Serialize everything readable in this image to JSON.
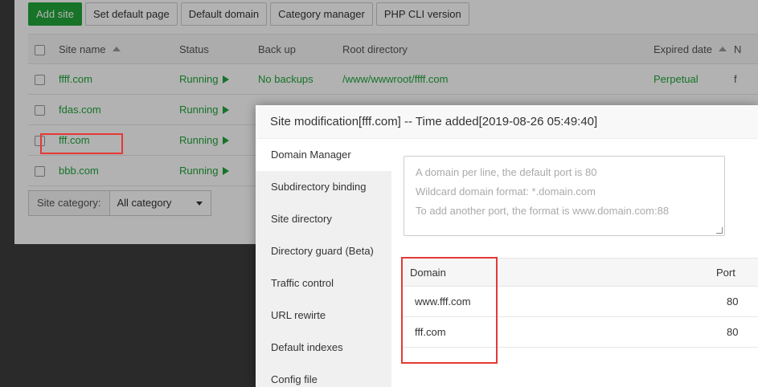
{
  "toolbar": {
    "add_site": "Add site",
    "set_default_page": "Set default page",
    "default_domain": "Default domain",
    "category_manager": "Category manager",
    "php_cli_version": "PHP CLI version"
  },
  "table": {
    "headers": {
      "site_name": "Site name",
      "status": "Status",
      "back_up": "Back up",
      "root_directory": "Root directory",
      "expired_date": "Expired date",
      "more": "N"
    },
    "rows": [
      {
        "name": "ffff.com",
        "status": "Running",
        "backup": "No backups",
        "root": "/www/wwwroot/ffff.com",
        "expired": "Perpetual",
        "more": "f"
      },
      {
        "name": "fdas.com",
        "status": "Running",
        "backup": "",
        "root": "",
        "expired": "",
        "more": ""
      },
      {
        "name": "fff.com",
        "status": "Running",
        "backup": "",
        "root": "",
        "expired": "",
        "more": ""
      },
      {
        "name": "bbb.com",
        "status": "Running",
        "backup": "",
        "root": "",
        "expired": "",
        "more": ""
      }
    ]
  },
  "category": {
    "label": "Site category:",
    "selected": "All category"
  },
  "modal": {
    "title": "Site modification[fff.com] -- Time added[2019-08-26 05:49:40]",
    "nav": [
      "Domain Manager",
      "Subdirectory binding",
      "Site directory",
      "Directory guard (Beta)",
      "Traffic control",
      "URL rewirte",
      "Default indexes",
      "Config file"
    ],
    "domain_input": {
      "placeholder_lines": [
        "A domain per line, the default port is 80",
        "Wildcard domain format: *.domain.com",
        "To add another port, the format is www.domain.com:88"
      ]
    },
    "domain_table": {
      "col_domain": "Domain",
      "col_port": "Port",
      "rows": [
        {
          "domain": "www.fff.com",
          "port": "80"
        },
        {
          "domain": "fff.com",
          "port": "80"
        }
      ]
    }
  },
  "colors": {
    "accent_green": "#20a53a",
    "highlight_red": "#e53935"
  }
}
